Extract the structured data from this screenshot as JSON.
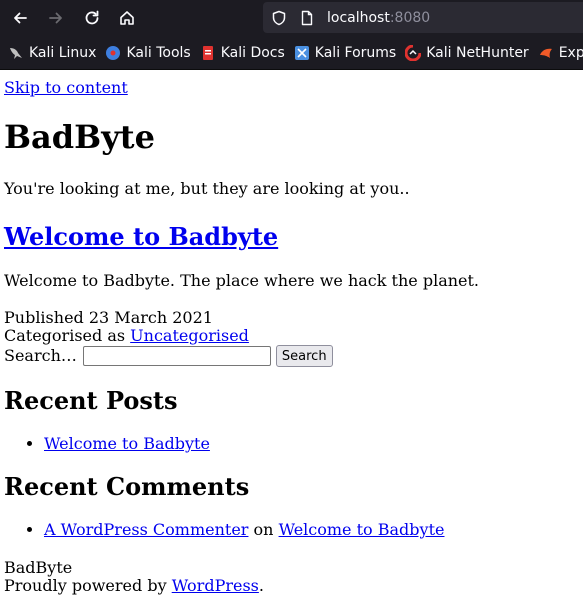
{
  "browser": {
    "url_host": "localhost",
    "url_port": ":8080",
    "bookmarks": [
      {
        "label": "Kali Linux",
        "icon": "kali-dragon-icon",
        "color": "#bfbfbf"
      },
      {
        "label": "Kali Tools",
        "icon": "kali-tools-icon",
        "color": "#3e7fe0"
      },
      {
        "label": "Kali Docs",
        "icon": "kali-docs-icon",
        "color": "#e0322f"
      },
      {
        "label": "Kali Forums",
        "icon": "kali-forums-icon",
        "color": "#4a90e2"
      },
      {
        "label": "Kali NetHunter",
        "icon": "kali-nethunter-icon",
        "color": "#e0322f"
      },
      {
        "label": "Exploi",
        "icon": "exploit-db-icon",
        "color": "#f05a28"
      }
    ]
  },
  "page": {
    "skip_link": "Skip to content",
    "site_title": "BadByte",
    "tagline": "You're looking at me, but they are looking at you..",
    "post_title": "Welcome to Badbyte",
    "post_body": "Welcome to Badbyte. The place where we hack the planet.",
    "published": "Published 23 March 2021",
    "categorised_prefix": "Categorised as ",
    "category": "Uncategorised",
    "search_label": "Search…",
    "search_value": "",
    "search_button": "Search",
    "recent_posts_heading": "Recent Posts",
    "recent_posts": [
      "Welcome to Badbyte"
    ],
    "recent_comments_heading": "Recent Comments",
    "recent_comment": {
      "author": "A WordPress Commenter",
      "on": " on ",
      "post": "Welcome to Badbyte"
    },
    "footer_site": "BadByte",
    "footer_powered": "Proudly powered by ",
    "footer_wordpress": "WordPress",
    "footer_period": "."
  }
}
